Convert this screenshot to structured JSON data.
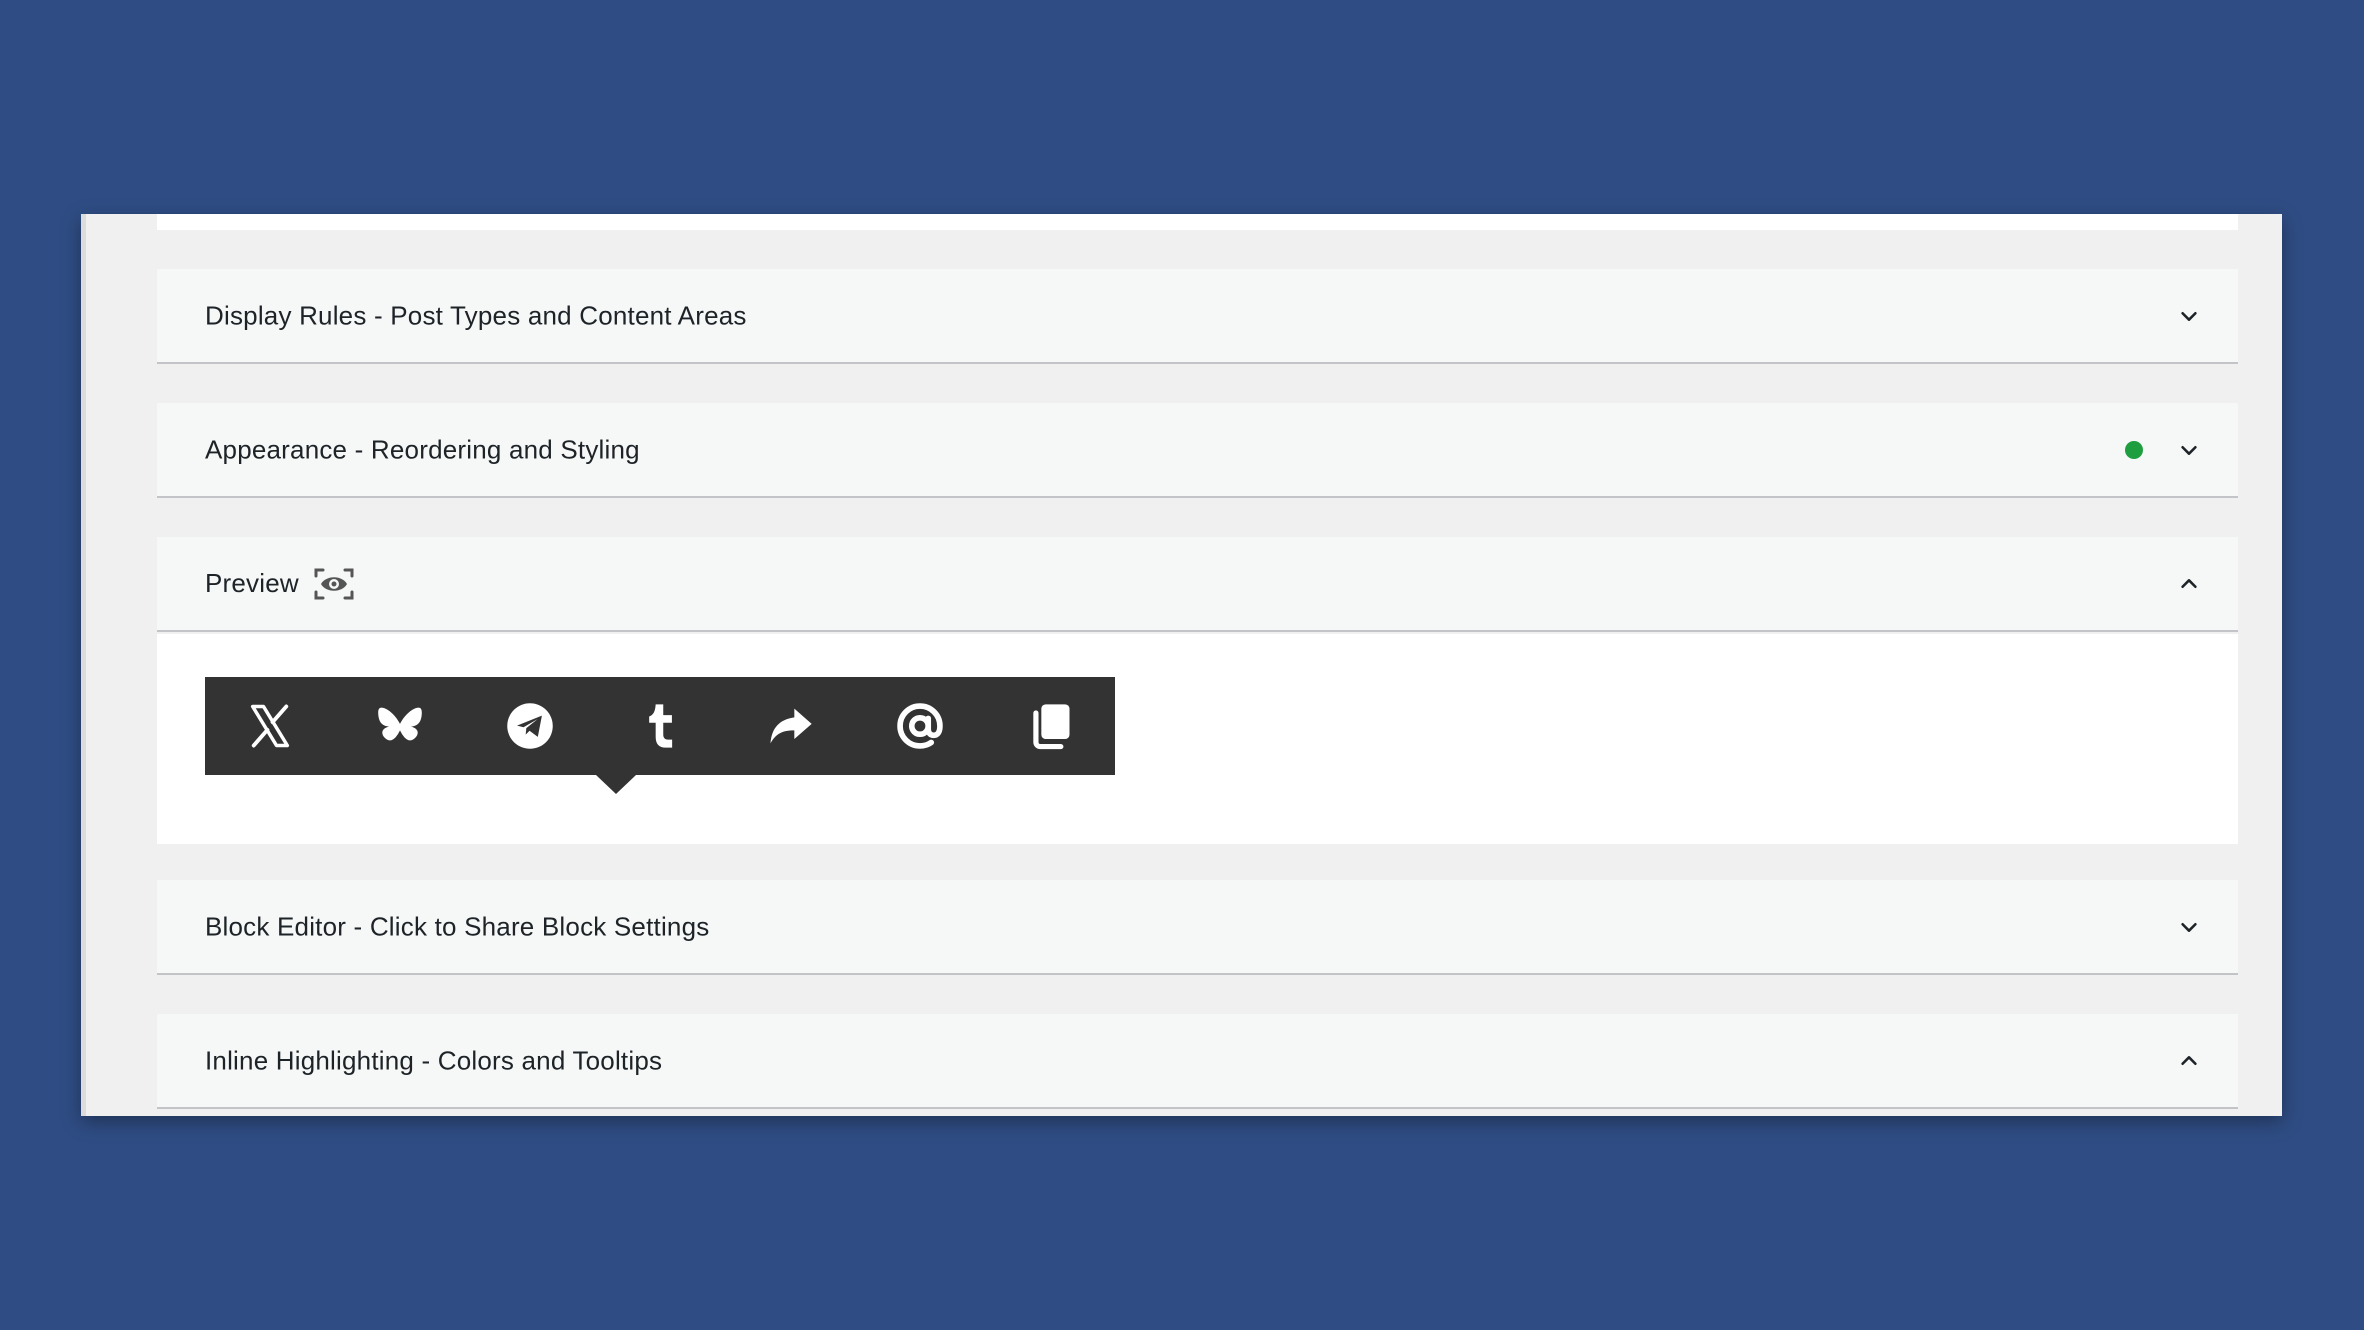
{
  "colors": {
    "background": "#2f4d84",
    "panel": "#f6f7f7",
    "sharebar": "#333333",
    "status_dot": "#1e9e3e",
    "icon": "#ffffff"
  },
  "panels": [
    {
      "title": "Display Rules - Post Types and Content Areas",
      "state": "collapsed"
    },
    {
      "title": "Appearance - Reordering and Styling",
      "state": "collapsed",
      "status": "active-green-dot"
    },
    {
      "title": "Preview",
      "state": "expanded",
      "title_icon": "eye-scan-icon"
    },
    {
      "title": "Block Editor - Click to Share Block Settings",
      "state": "collapsed"
    },
    {
      "title": "Inline Highlighting - Colors and Tooltips",
      "state": "expanded"
    }
  ],
  "sharebar": {
    "buttons": [
      {
        "icon": "x-icon"
      },
      {
        "icon": "bluesky-butterfly-icon"
      },
      {
        "icon": "telegram-icon"
      },
      {
        "icon": "tumblr-icon"
      },
      {
        "icon": "share-arrow-icon"
      },
      {
        "icon": "email-at-icon"
      },
      {
        "icon": "copy-icon"
      }
    ]
  }
}
